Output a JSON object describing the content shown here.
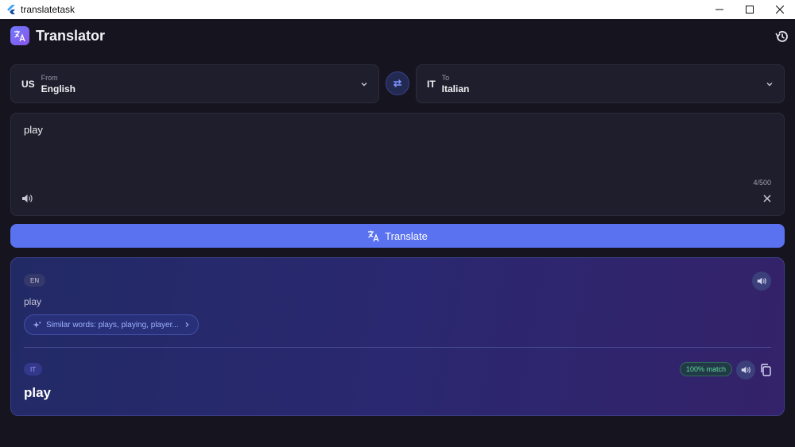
{
  "window": {
    "title": "translatetask"
  },
  "header": {
    "app_title": "Translator"
  },
  "languages": {
    "from": {
      "code": "US",
      "caption": "From",
      "name": "English"
    },
    "to": {
      "code": "IT",
      "caption": "To",
      "name": "Italian"
    }
  },
  "input": {
    "text": "play",
    "char_count": "4/500"
  },
  "translate_button": {
    "label": "Translate"
  },
  "result": {
    "source": {
      "lang_badge": "EN",
      "text": "play",
      "similar_words": "Similar words: plays, playing, player..."
    },
    "target": {
      "lang_badge": "IT",
      "text": "play",
      "match": "100% match"
    }
  },
  "colors": {
    "accent": "#5a72f0",
    "background": "#16151f",
    "match_green": "#5fd69a"
  },
  "icons": [
    "translate-icon",
    "history-icon",
    "chevron-down-icon",
    "swap-icon",
    "speaker-icon",
    "close-icon",
    "sparkle-icon",
    "chevron-right-icon",
    "copy-icon"
  ]
}
